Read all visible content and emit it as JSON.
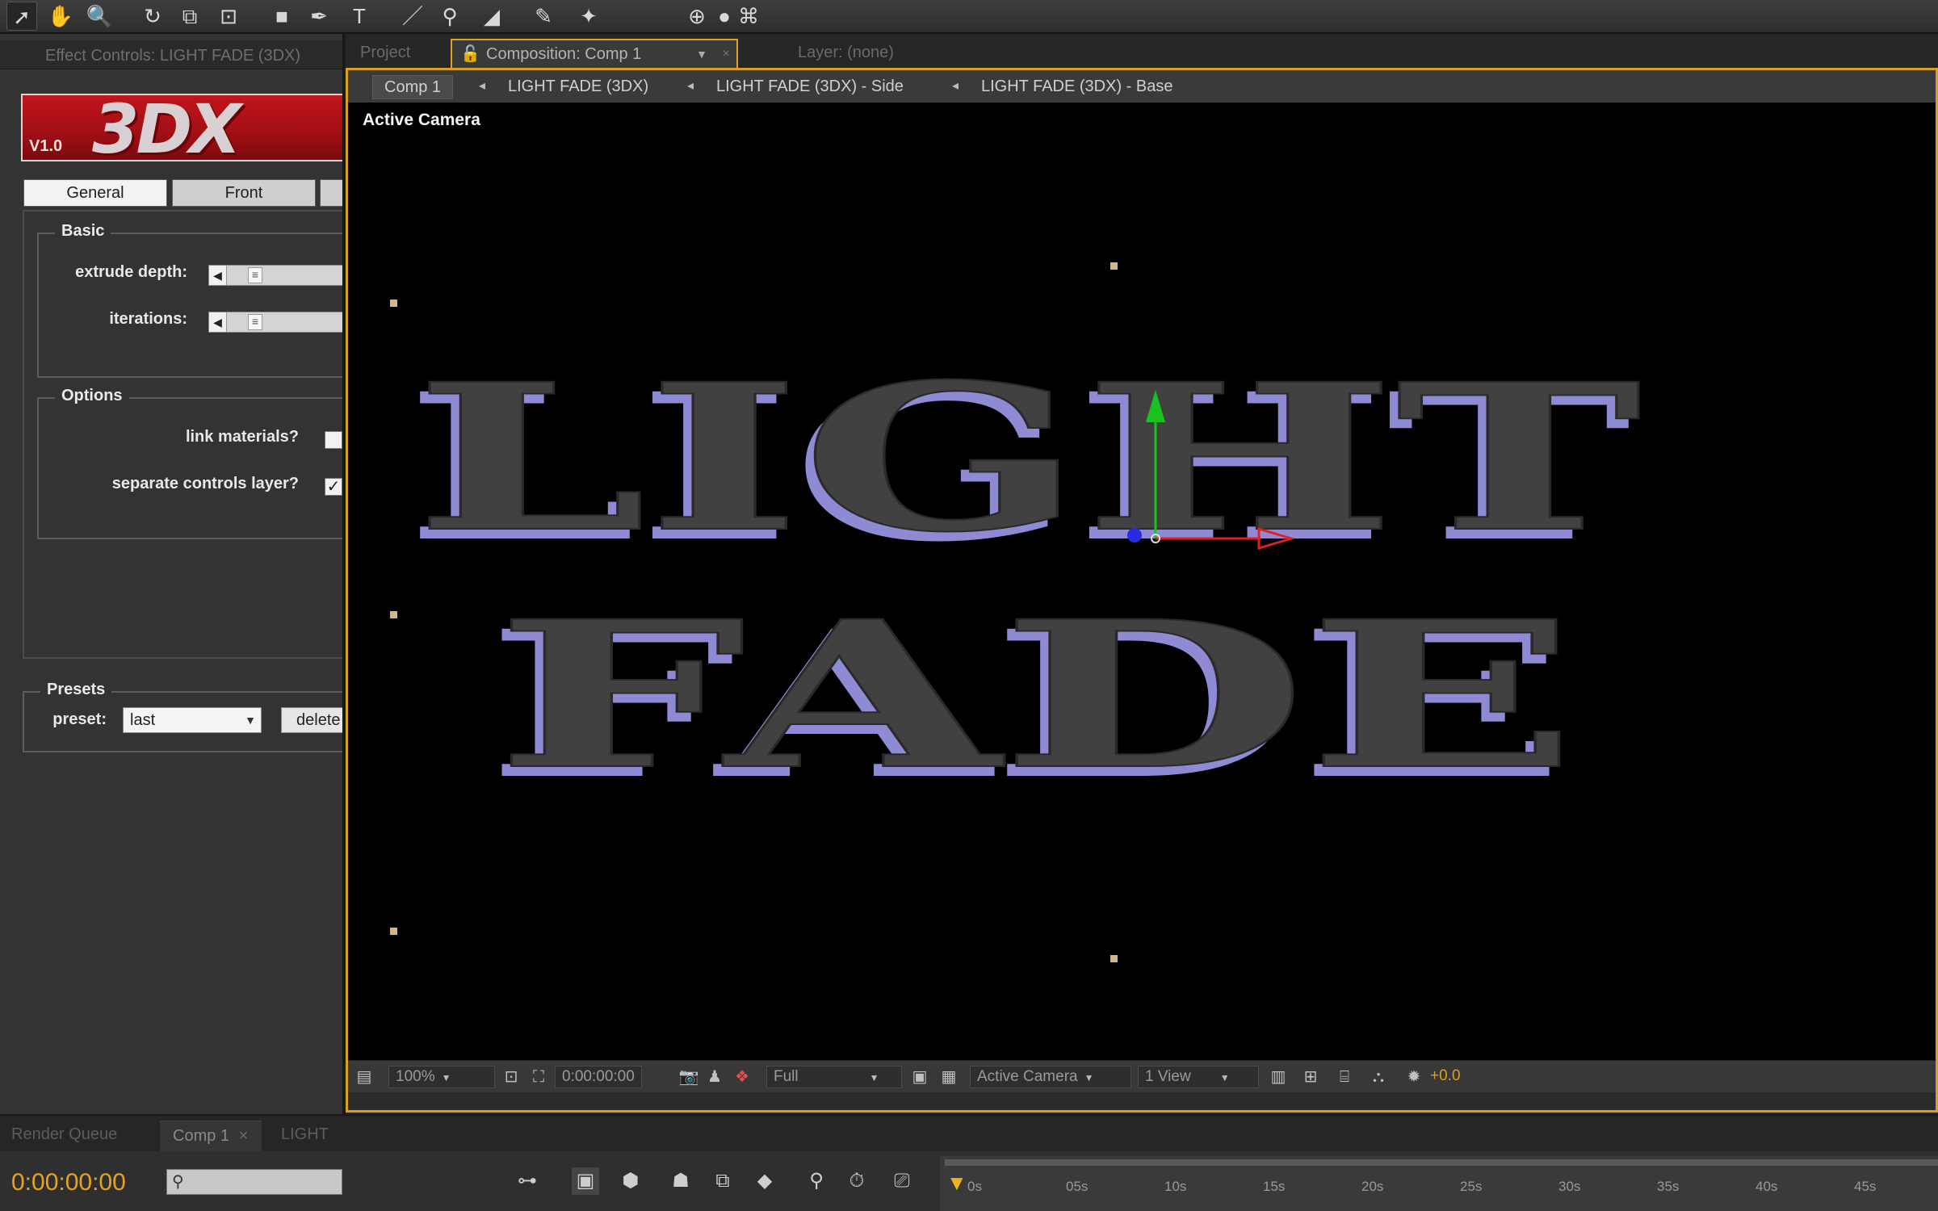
{
  "toolbar": {
    "tools": [
      {
        "name": "selection-tool",
        "glyph": "➚"
      },
      {
        "name": "hand-tool",
        "glyph": "✋"
      },
      {
        "name": "zoom-tool",
        "glyph": "🔍"
      },
      {
        "name": "rotation-tool",
        "glyph": "↻"
      },
      {
        "name": "camera-tool",
        "glyph": "⧉"
      },
      {
        "name": "pan-behind-tool",
        "glyph": "⊡"
      },
      {
        "name": "rectangle-tool",
        "glyph": "■"
      },
      {
        "name": "pen-tool",
        "glyph": "✒"
      },
      {
        "name": "type-tool",
        "glyph": "T"
      },
      {
        "name": "brush-tool",
        "glyph": "／"
      },
      {
        "name": "clone-stamp-tool",
        "glyph": "⚲"
      },
      {
        "name": "eraser-tool",
        "glyph": "◢"
      },
      {
        "name": "roto-brush-tool",
        "glyph": "✎"
      },
      {
        "name": "puppet-pin-tool",
        "glyph": "✦"
      },
      {
        "name": "local-axis-mode",
        "glyph": "⊕"
      },
      {
        "name": "world-axis-mode",
        "glyph": "●"
      },
      {
        "name": "view-axis-mode",
        "glyph": "⌘"
      }
    ]
  },
  "effect_controls": {
    "tab_label": "Effect Controls: LIGHT  FADE (3DX)",
    "plugin": {
      "logo": "3DX",
      "version": "V1.0"
    },
    "tabs": [
      "General",
      "Front",
      ""
    ],
    "basic": {
      "legend": "Basic",
      "params": [
        {
          "label": "extrude depth:",
          "arrow": "◀",
          "thumb": "≡"
        },
        {
          "label": "iterations:",
          "arrow": "◀",
          "thumb": "≡"
        }
      ]
    },
    "options": {
      "legend": "Options",
      "checks": [
        {
          "label": "link materials?",
          "checked": false,
          "mark": ""
        },
        {
          "label": "separate controls layer?",
          "checked": true,
          "mark": "✓"
        }
      ]
    },
    "presets": {
      "legend": "Presets",
      "label": "preset:",
      "value": "last",
      "delete_label": "delete"
    }
  },
  "composition_panel": {
    "tabs": {
      "project": "Project",
      "composition": "Composition: Comp 1",
      "layer": "Layer: (none)"
    },
    "breadcrumbs": [
      "Comp 1",
      "LIGHT  FADE (3DX)",
      "LIGHT  FADE (3DX) - Side",
      "LIGHT  FADE (3DX) - Base"
    ],
    "viewer": {
      "label": "Active Camera",
      "scene_text": [
        "LIGHT",
        "FADE"
      ],
      "colors": {
        "face": "#414141",
        "extrusion": "#8e8ad4",
        "x_axis": "#e02020",
        "y_axis": "#19c21d",
        "z_axis": "#2a2ae0"
      }
    },
    "bottom_bar": {
      "magnification": "100%",
      "timecode": "0:00:00:00",
      "resolution": "Full",
      "camera": "Active Camera",
      "views": "1 View",
      "exposure": "+0.0"
    }
  },
  "timeline": {
    "tabs": [
      "Render Queue",
      "Comp 1",
      "LIGHT"
    ],
    "close_glyph": "×",
    "timecode": "0:00:00:00",
    "search_placeholder": "⚲",
    "ruler_ticks": [
      "0s",
      "05s",
      "10s",
      "15s",
      "20s",
      "25s",
      "30s",
      "35s",
      "40s",
      "45s"
    ],
    "accent_color": "#e8a31e"
  }
}
